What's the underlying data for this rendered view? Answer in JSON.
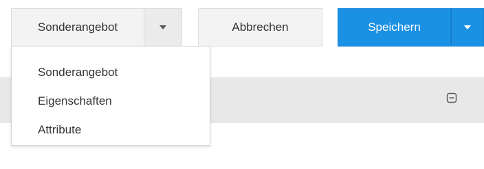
{
  "toolbar": {
    "split_label": "Sonderangebot",
    "cancel_label": "Abbrechen",
    "save_label": "Speichern"
  },
  "dropdown": {
    "items": [
      {
        "label": "Sonderangebot"
      },
      {
        "label": "Eigenschaften"
      },
      {
        "label": "Attribute"
      }
    ]
  },
  "panel": {
    "collapse_icon": "minus-square-icon"
  },
  "colors": {
    "primary": "#1b91e4",
    "panel_bg": "#e8e8e8",
    "button_bg": "#f3f3f3"
  },
  "icons": {
    "dropdown_caret": "caret-down-icon",
    "save_caret": "caret-down-icon"
  }
}
